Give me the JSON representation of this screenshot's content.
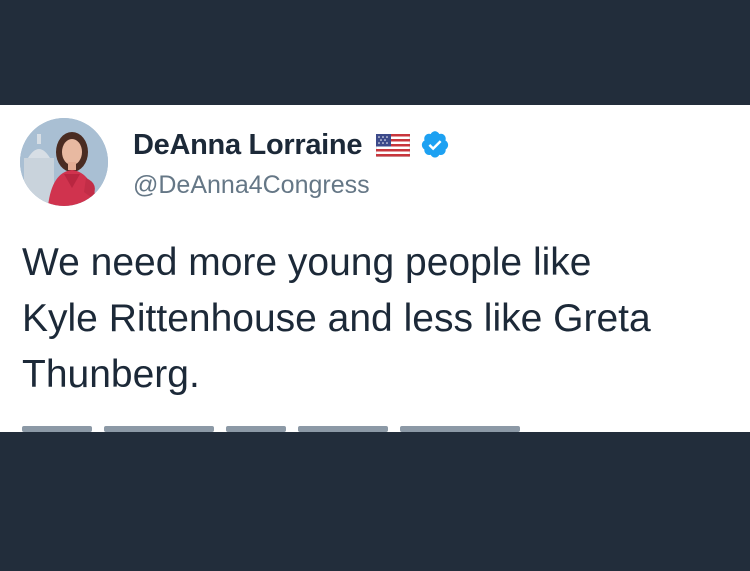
{
  "tweet": {
    "display_name": "DeAnna Lorraine",
    "handle": "@DeAnna4Congress",
    "text": "We need more young people like\nKyle Rittenhouse and less like Greta\nThunberg.",
    "icons": {
      "flag": "us-flag-icon",
      "verified": "verified-badge-icon"
    }
  },
  "colors": {
    "background": "#222d3b",
    "card": "#ffffff",
    "name_text": "#1c2938",
    "handle_text": "#657786",
    "verified_blue": "#1da1f2"
  }
}
